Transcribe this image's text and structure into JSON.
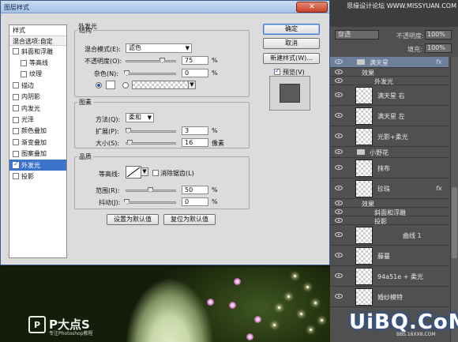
{
  "dialog": {
    "title": "图层样式",
    "close_label": "✕",
    "styles_header": "样式",
    "blend_options": "混合选项:自定",
    "style_items": [
      {
        "label": "斜面和浮雕",
        "checked": false,
        "sub": false
      },
      {
        "label": "等高线",
        "checked": false,
        "sub": true
      },
      {
        "label": "纹理",
        "checked": false,
        "sub": true
      },
      {
        "label": "描边",
        "checked": false,
        "sub": false
      },
      {
        "label": "内阴影",
        "checked": false,
        "sub": false
      },
      {
        "label": "内发光",
        "checked": false,
        "sub": false
      },
      {
        "label": "光泽",
        "checked": false,
        "sub": false
      },
      {
        "label": "颜色叠加",
        "checked": false,
        "sub": false
      },
      {
        "label": "渐变叠加",
        "checked": false,
        "sub": false
      },
      {
        "label": "图案叠加",
        "checked": false,
        "sub": false
      },
      {
        "label": "外发光",
        "checked": true,
        "sub": false,
        "active": true
      },
      {
        "label": "投影",
        "checked": false,
        "sub": false
      }
    ],
    "panel_title": "外发光",
    "structure": {
      "legend": "结构",
      "blend_mode_label": "混合模式(E):",
      "blend_mode_value": "滤色",
      "opacity_label": "不透明度(O):",
      "opacity_value": "75",
      "opacity_unit": "%",
      "opacity_fraction": 0.75,
      "noise_label": "杂色(N):",
      "noise_value": "0",
      "noise_unit": "%",
      "noise_fraction": 0.0
    },
    "elements": {
      "legend": "图素",
      "method_label": "方法(Q):",
      "method_value": "柔和",
      "spread_label": "扩展(P):",
      "spread_value": "3",
      "spread_unit": "%",
      "spread_fraction": 0.03,
      "size_label": "大小(S):",
      "size_value": "16",
      "size_unit": "像素",
      "size_fraction": 0.065
    },
    "quality": {
      "legend": "品质",
      "contour_label": "等高线:",
      "antialias_label": "消除锯齿(L)",
      "range_label": "范围(R):",
      "range_value": "50",
      "range_unit": "%",
      "range_fraction": 0.5,
      "jitter_label": "抖动(J):",
      "jitter_value": "0",
      "jitter_unit": "%",
      "jitter_fraction": 0.0
    },
    "buttons": {
      "ok": "确定",
      "cancel": "取消",
      "new_style": "新建样式(W)...",
      "preview": "预览(V)",
      "set_default": "设置为默认值",
      "reset_default": "复位为默认值"
    }
  },
  "layers_panel": {
    "watermark": "思缘设计论坛 WWW.MISSYUAN.COM",
    "blend_mode": "穿透",
    "opacity_label": "不透明度:",
    "opacity_value": "100%",
    "fill_label": "填充:",
    "fill_value": "100%",
    "layers": [
      {
        "name": "满天星",
        "type": "group",
        "fx": "fx",
        "selected": true
      },
      {
        "name": "效果",
        "type": "effect"
      },
      {
        "name": "外发光",
        "type": "effect-sub"
      },
      {
        "name": "满天星 右",
        "type": "layer"
      },
      {
        "name": "满天星 左",
        "type": "layer"
      },
      {
        "name": "光影+柔光",
        "type": "layer"
      },
      {
        "name": "小野花",
        "type": "group"
      },
      {
        "name": "抹布",
        "type": "layer"
      },
      {
        "name": "珍珠",
        "type": "layer",
        "fx": "fx"
      },
      {
        "name": "效果",
        "type": "effect"
      },
      {
        "name": "斜面和浮雕",
        "type": "effect-sub"
      },
      {
        "name": "投影",
        "type": "effect-sub"
      },
      {
        "name": "曲线 1",
        "type": "adjustment"
      },
      {
        "name": "藤蔓",
        "type": "layer"
      },
      {
        "name": "94a51e + 柔光",
        "type": "layer"
      },
      {
        "name": "婚纱模特",
        "type": "layer"
      }
    ]
  },
  "branding": {
    "logo_mark": "P",
    "logo_text": "P大点S",
    "logo_sub": "专注Photoshop教程",
    "uibq": "UiBQ.CoM",
    "uibq_sub": "BBS.16XX8.COM"
  },
  "colors": {
    "accent": "#3d74c9",
    "titlebar": "#a4c2e6",
    "panel_bg": "#505050",
    "selected_layer": "#6d7f9b"
  }
}
